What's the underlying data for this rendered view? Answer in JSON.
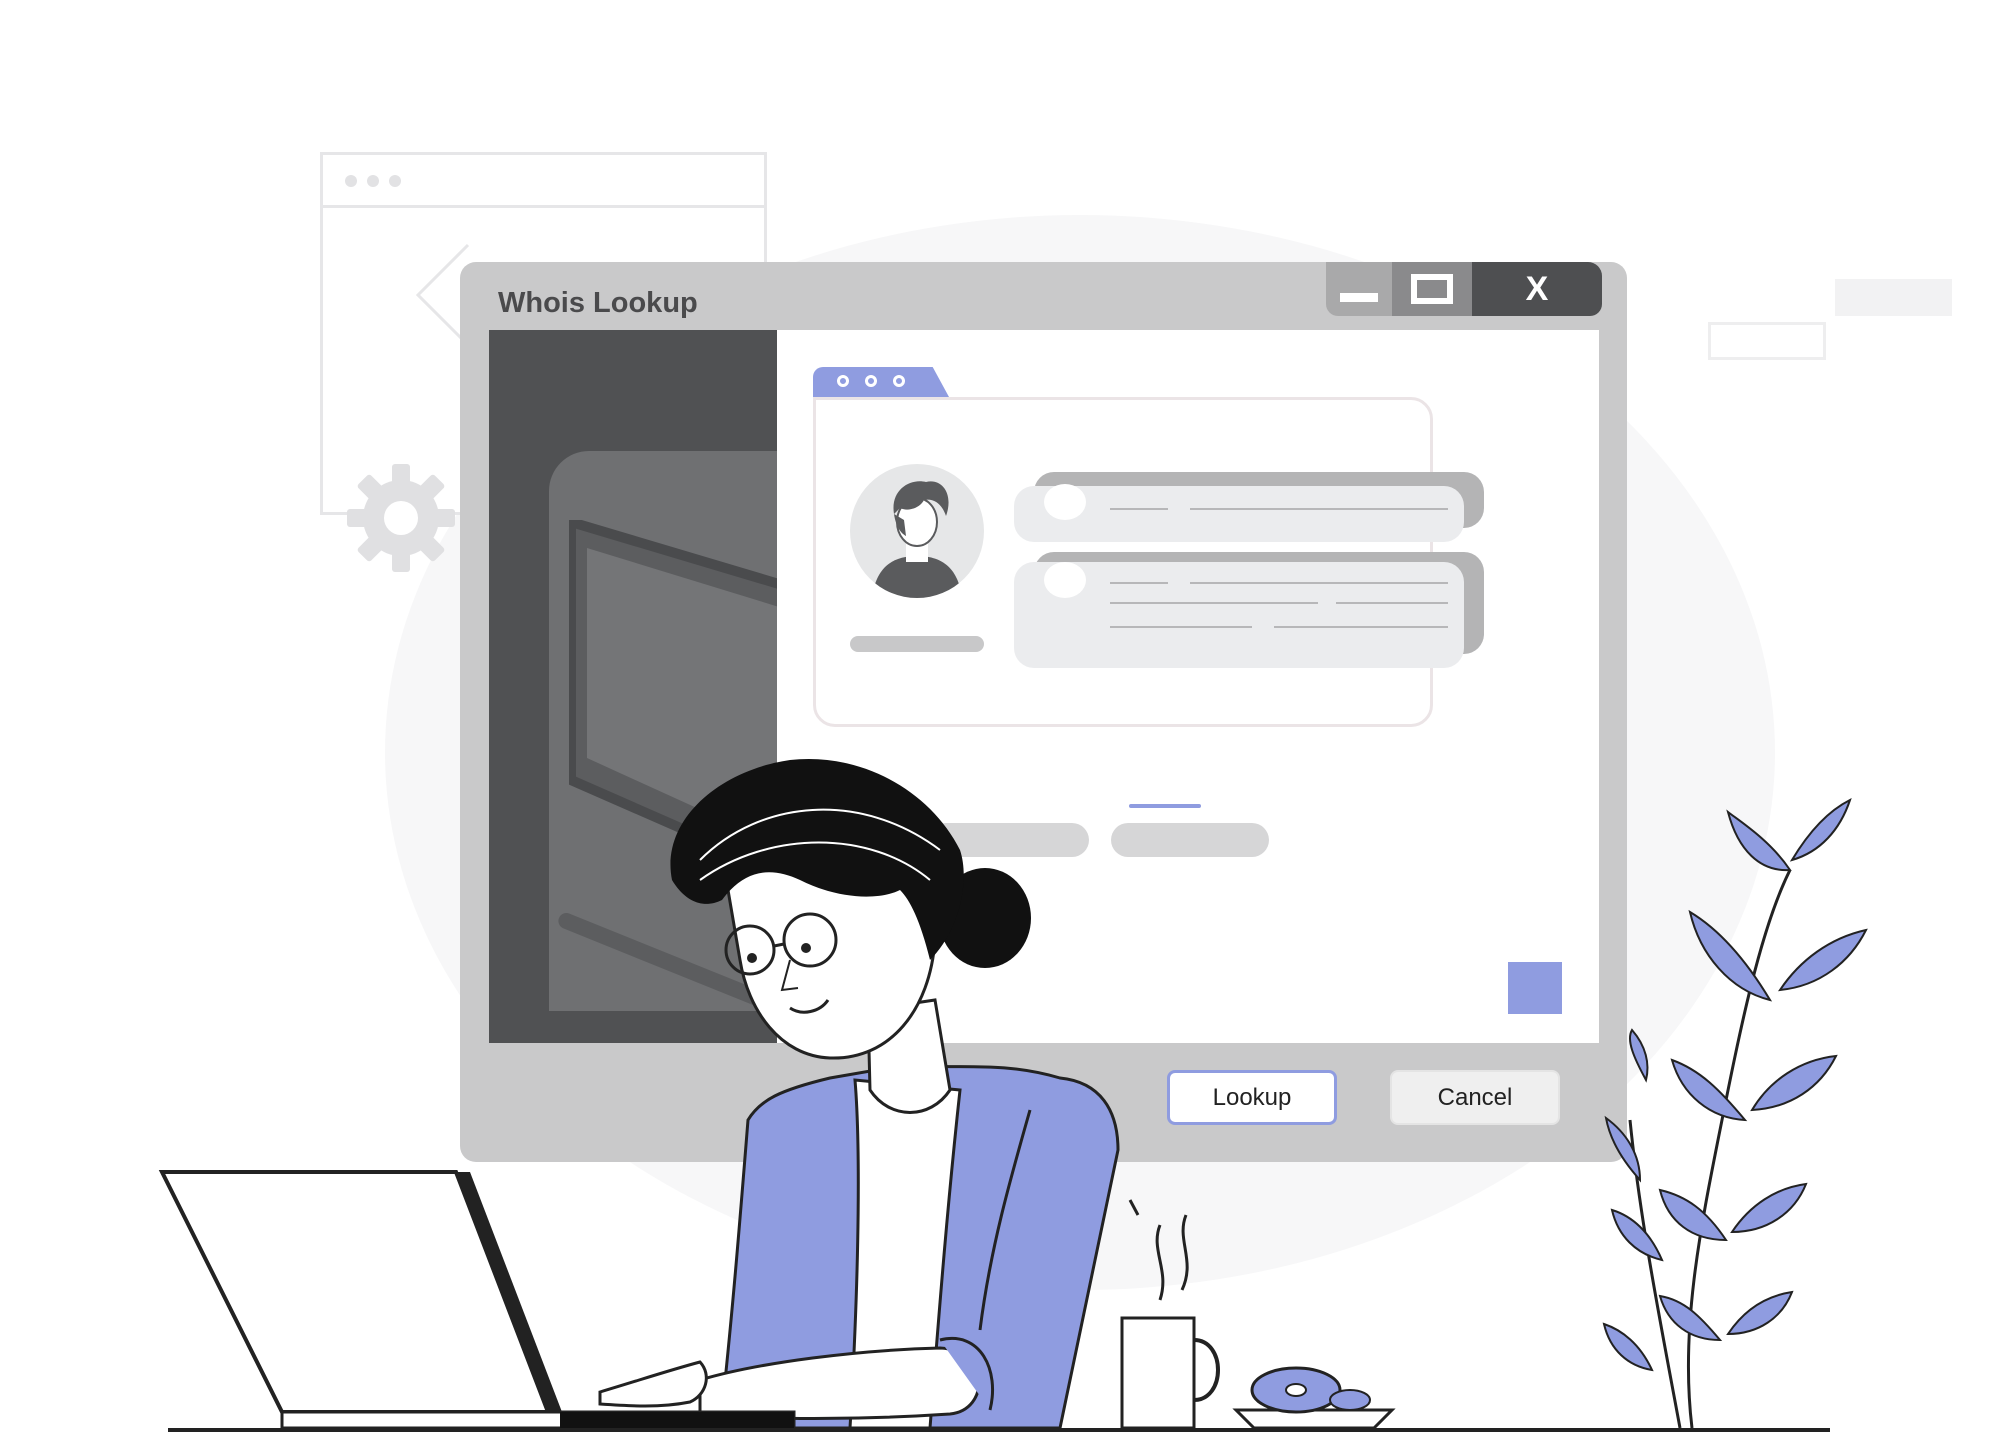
{
  "dialog": {
    "title": "Whois Lookup",
    "window_controls": {
      "minimize_icon": "minimize-icon",
      "maximize_icon": "maximize-icon",
      "close_label": "X"
    },
    "buttons": {
      "lookup_label": "Lookup",
      "cancel_label": "Cancel"
    }
  },
  "profile_card": {
    "avatar_icon": "user-avatar-icon"
  },
  "colors": {
    "accent": "#8f9ce0",
    "dialog_frame": "#c9c9ca",
    "side_panel": "#505153",
    "close_button": "#4e4f51"
  }
}
